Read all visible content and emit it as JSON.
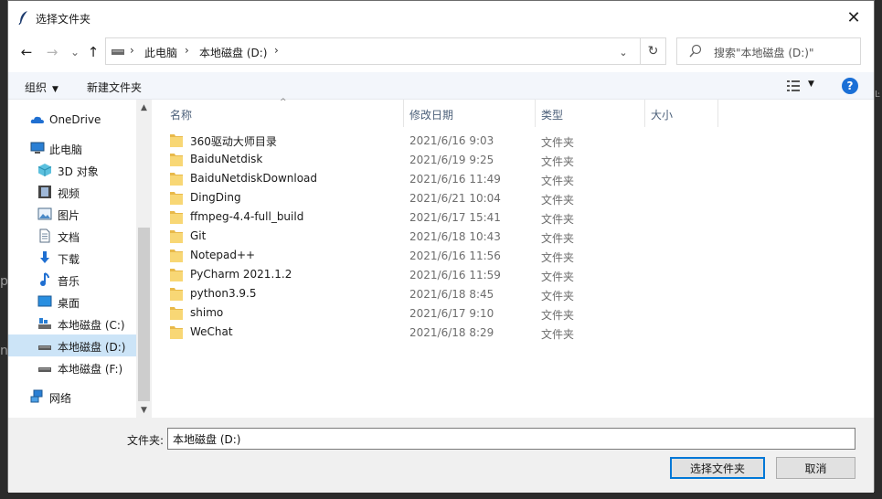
{
  "window": {
    "title": "选择文件夹",
    "close_glyph": "✕"
  },
  "background": {
    "left_glyphs": [
      "p",
      "n"
    ],
    "right_glyph": "Ŀ"
  },
  "nav": {
    "back_glyph": "←",
    "forward_glyph": "→",
    "history_glyph": "⌄",
    "up_glyph": "↑",
    "breadcrumb": [
      "此电脑",
      "本地磁盘 (D:)"
    ],
    "separator": "›",
    "dropdown_glyph": "⌄",
    "refresh_glyph": "↻",
    "search_placeholder": "搜索\"本地磁盘 (D:)\""
  },
  "toolbar": {
    "organize_label": "组织",
    "organize_caret": "▼",
    "new_folder_label": "新建文件夹",
    "view_caret": "▼",
    "help_glyph": "?"
  },
  "sidebar": {
    "items": [
      {
        "label": "OneDrive",
        "icon": "cloud-icon"
      },
      {
        "label": "此电脑",
        "icon": "computer-icon"
      },
      {
        "label": "3D 对象",
        "icon": "cube-icon"
      },
      {
        "label": "视频",
        "icon": "video-icon"
      },
      {
        "label": "图片",
        "icon": "picture-icon"
      },
      {
        "label": "文档",
        "icon": "document-icon"
      },
      {
        "label": "下载",
        "icon": "download-icon"
      },
      {
        "label": "音乐",
        "icon": "music-icon"
      },
      {
        "label": "桌面",
        "icon": "desktop-icon"
      },
      {
        "label": "本地磁盘 (C:)",
        "icon": "drive-icon"
      },
      {
        "label": "本地磁盘 (D:)",
        "icon": "drive-icon",
        "selected": true
      },
      {
        "label": "本地磁盘 (F:)",
        "icon": "drive-icon"
      },
      {
        "label": "网络",
        "icon": "network-icon"
      }
    ],
    "scroll_up_glyph": "▲",
    "scroll_down_glyph": "▼"
  },
  "columns": [
    "名称",
    "修改日期",
    "类型",
    "大小"
  ],
  "sort_glyph": "^",
  "files": [
    {
      "name": "360驱动大师目录",
      "date": "2021/6/16 9:03",
      "type": "文件夹"
    },
    {
      "name": "BaiduNetdisk",
      "date": "2021/6/19 9:25",
      "type": "文件夹"
    },
    {
      "name": "BaiduNetdiskDownload",
      "date": "2021/6/16 11:49",
      "type": "文件夹"
    },
    {
      "name": "DingDing",
      "date": "2021/6/21 10:04",
      "type": "文件夹"
    },
    {
      "name": "ffmpeg-4.4-full_build",
      "date": "2021/6/17 15:41",
      "type": "文件夹"
    },
    {
      "name": "Git",
      "date": "2021/6/18 10:43",
      "type": "文件夹"
    },
    {
      "name": "Notepad++",
      "date": "2021/6/16 11:56",
      "type": "文件夹"
    },
    {
      "name": "PyCharm 2021.1.2",
      "date": "2021/6/16 11:59",
      "type": "文件夹"
    },
    {
      "name": "python3.9.5",
      "date": "2021/6/18 8:45",
      "type": "文件夹"
    },
    {
      "name": "shimo",
      "date": "2021/6/17 9:10",
      "type": "文件夹"
    },
    {
      "name": "WeChat",
      "date": "2021/6/18 8:29",
      "type": "文件夹"
    }
  ],
  "footer": {
    "folder_label": "文件夹:",
    "folder_value": "本地磁盘 (D:)",
    "select_button": "选择文件夹",
    "cancel_button": "取消"
  },
  "colors": {
    "accent": "#0078d7",
    "selection": "#cce4f7",
    "folder": "#f8d775",
    "help": "#1a6fd6"
  }
}
